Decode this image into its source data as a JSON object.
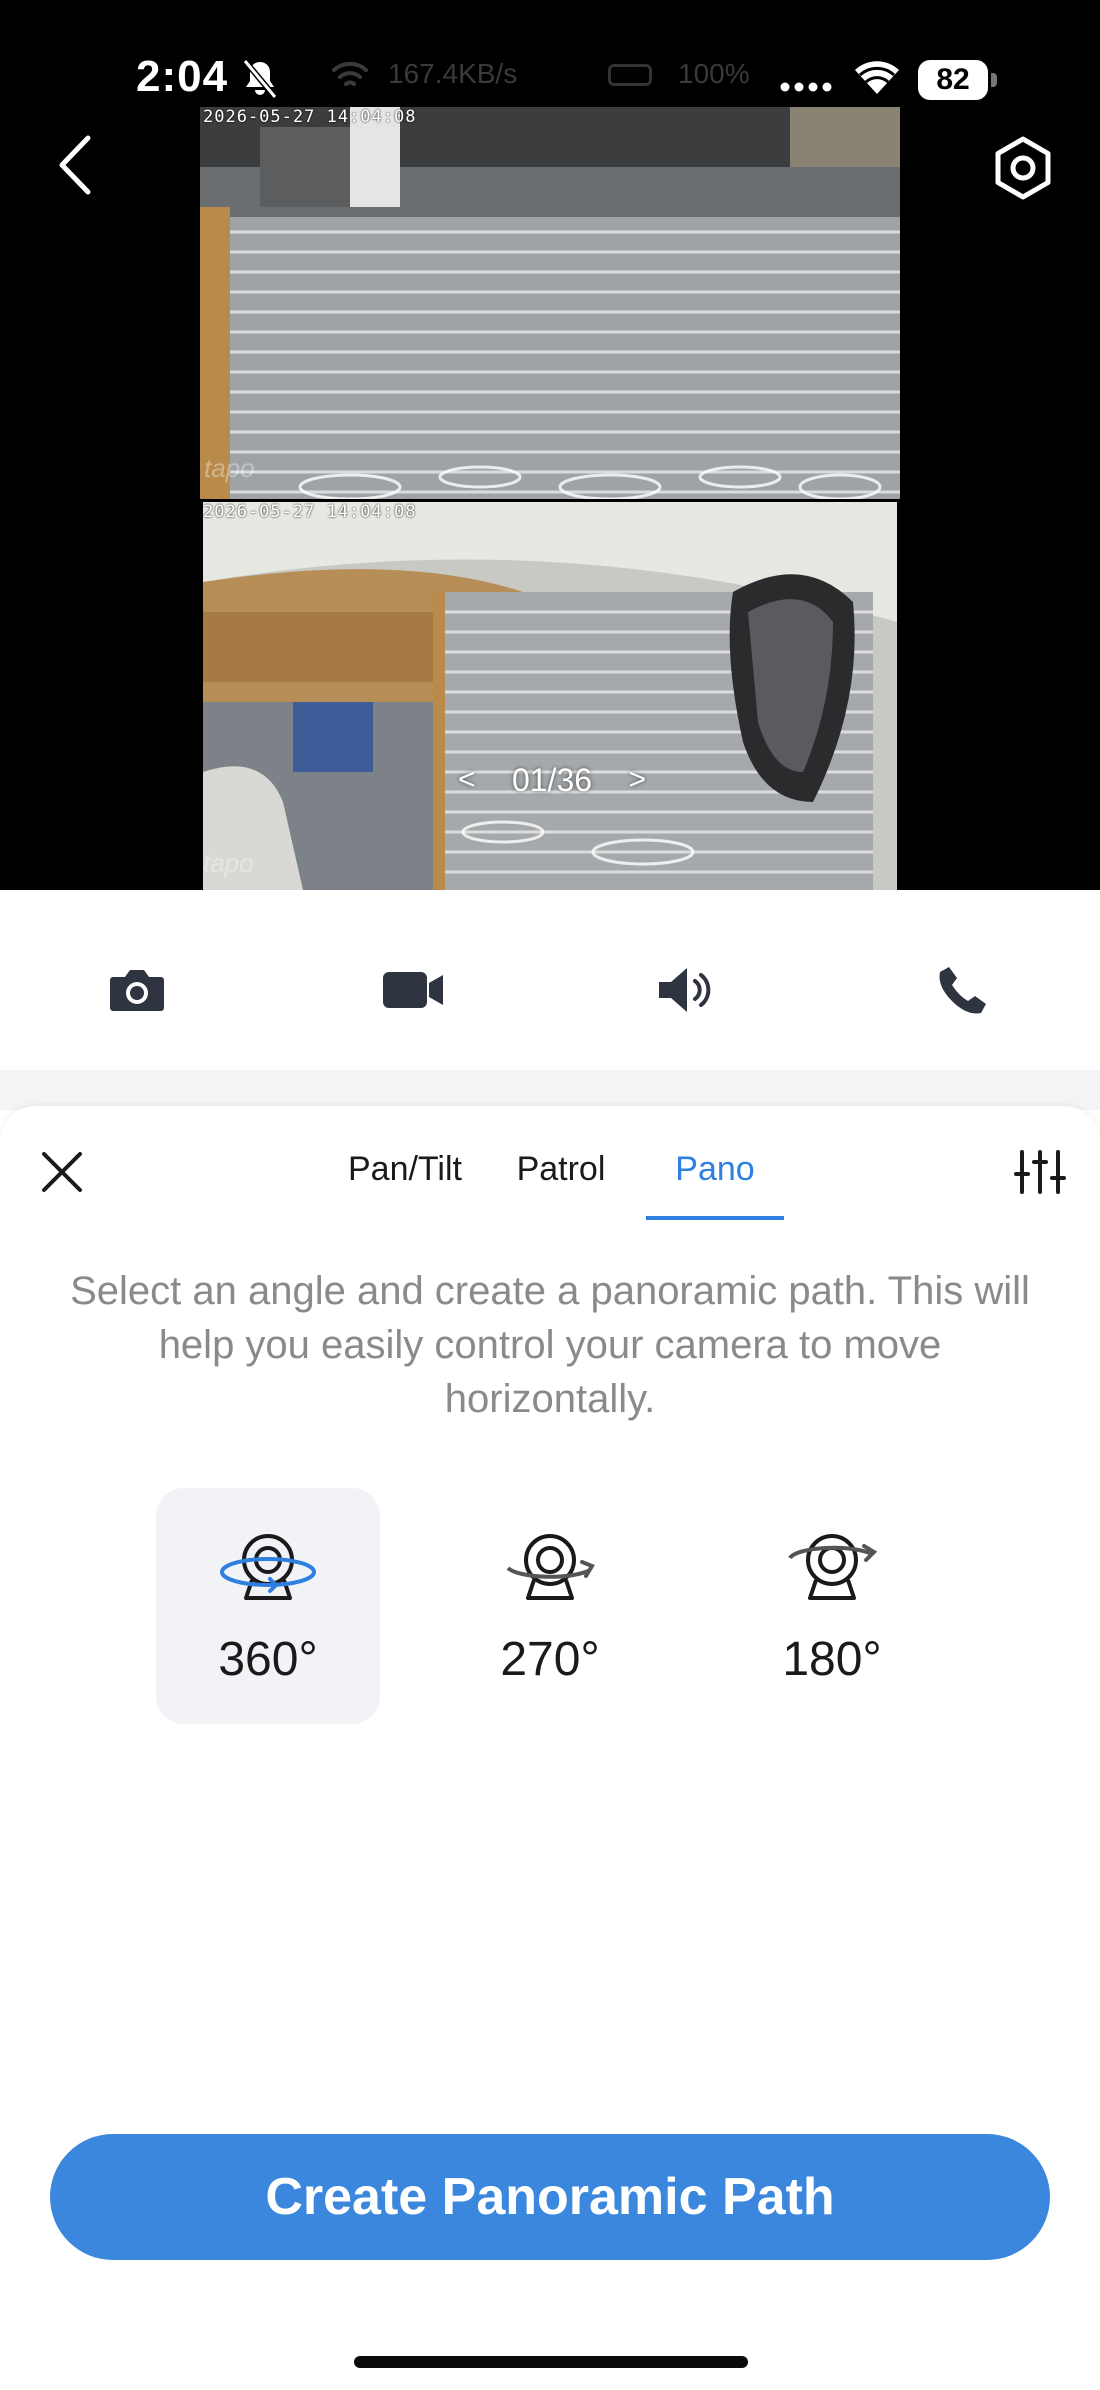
{
  "status_bar": {
    "time": "2:04",
    "network_speed": "167.4KB/s",
    "faded_percent": "100%",
    "battery": "82"
  },
  "camera": {
    "timestamp_top": "2026-05-27 14:04:08",
    "timestamp_bottom": "2026-05-27 14:04:08",
    "brand_watermark": "tapo",
    "page_prev": "<",
    "page_indicator": "01/36",
    "page_next": ">"
  },
  "controls": {
    "icons": [
      "camera-icon",
      "video-camera-icon",
      "speaker-icon",
      "phone-icon"
    ]
  },
  "sheet": {
    "tabs": [
      {
        "label": "Pan/Tilt",
        "active": false
      },
      {
        "label": "Patrol",
        "active": false
      },
      {
        "label": "Pano",
        "active": true
      }
    ],
    "description": "Select an angle and create a panoramic path. This will help you easily control your camera to move horizontally.",
    "angles": [
      {
        "label": "360°",
        "selected": true
      },
      {
        "label": "270°",
        "selected": false
      },
      {
        "label": "180°",
        "selected": false
      }
    ],
    "create_button": "Create Panoramic Path"
  },
  "colors": {
    "accent": "#3b87dd",
    "tab_active": "#2f7fe0",
    "description_text": "#8a8a8a",
    "selected_bg": "#f1f3f7"
  }
}
